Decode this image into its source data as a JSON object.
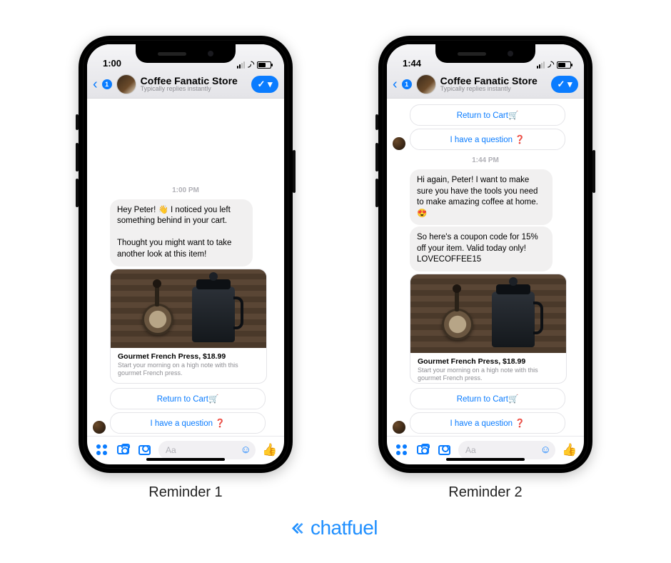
{
  "brand": "chatfuel",
  "captions": {
    "left": "Reminder 1",
    "right": "Reminder 2"
  },
  "phone_common": {
    "store_name": "Coffee Fanatic Store",
    "store_sub": "Typically replies instantly",
    "back_badge": "1",
    "composer_placeholder": "Aa",
    "card": {
      "title": "Gourmet French Press, $18.99",
      "desc": "Start your morning on a high note with this gourmet French press."
    },
    "qr": {
      "return": "Return to Cart🛒",
      "question": "I have a question",
      "qmark": " ❓"
    }
  },
  "phone1": {
    "clock": "1:00",
    "timestamp": "1:00 PM",
    "msg1": "Hey Peter! 👋 I noticed you left something behind in your cart.\n\nThought you might want to take another look at this item!"
  },
  "phone2": {
    "clock": "1:44",
    "top_qr_return": "Return to Cart🛒",
    "top_qr_question": "I have a question",
    "timestamp": "1:44 PM",
    "msg1": "Hi again, Peter! I want to make sure you have the tools you need to make amazing coffee at home. 😍",
    "msg2": "So here's a coupon code for 15% off your item. Valid today only! LOVECOFFEE15"
  }
}
